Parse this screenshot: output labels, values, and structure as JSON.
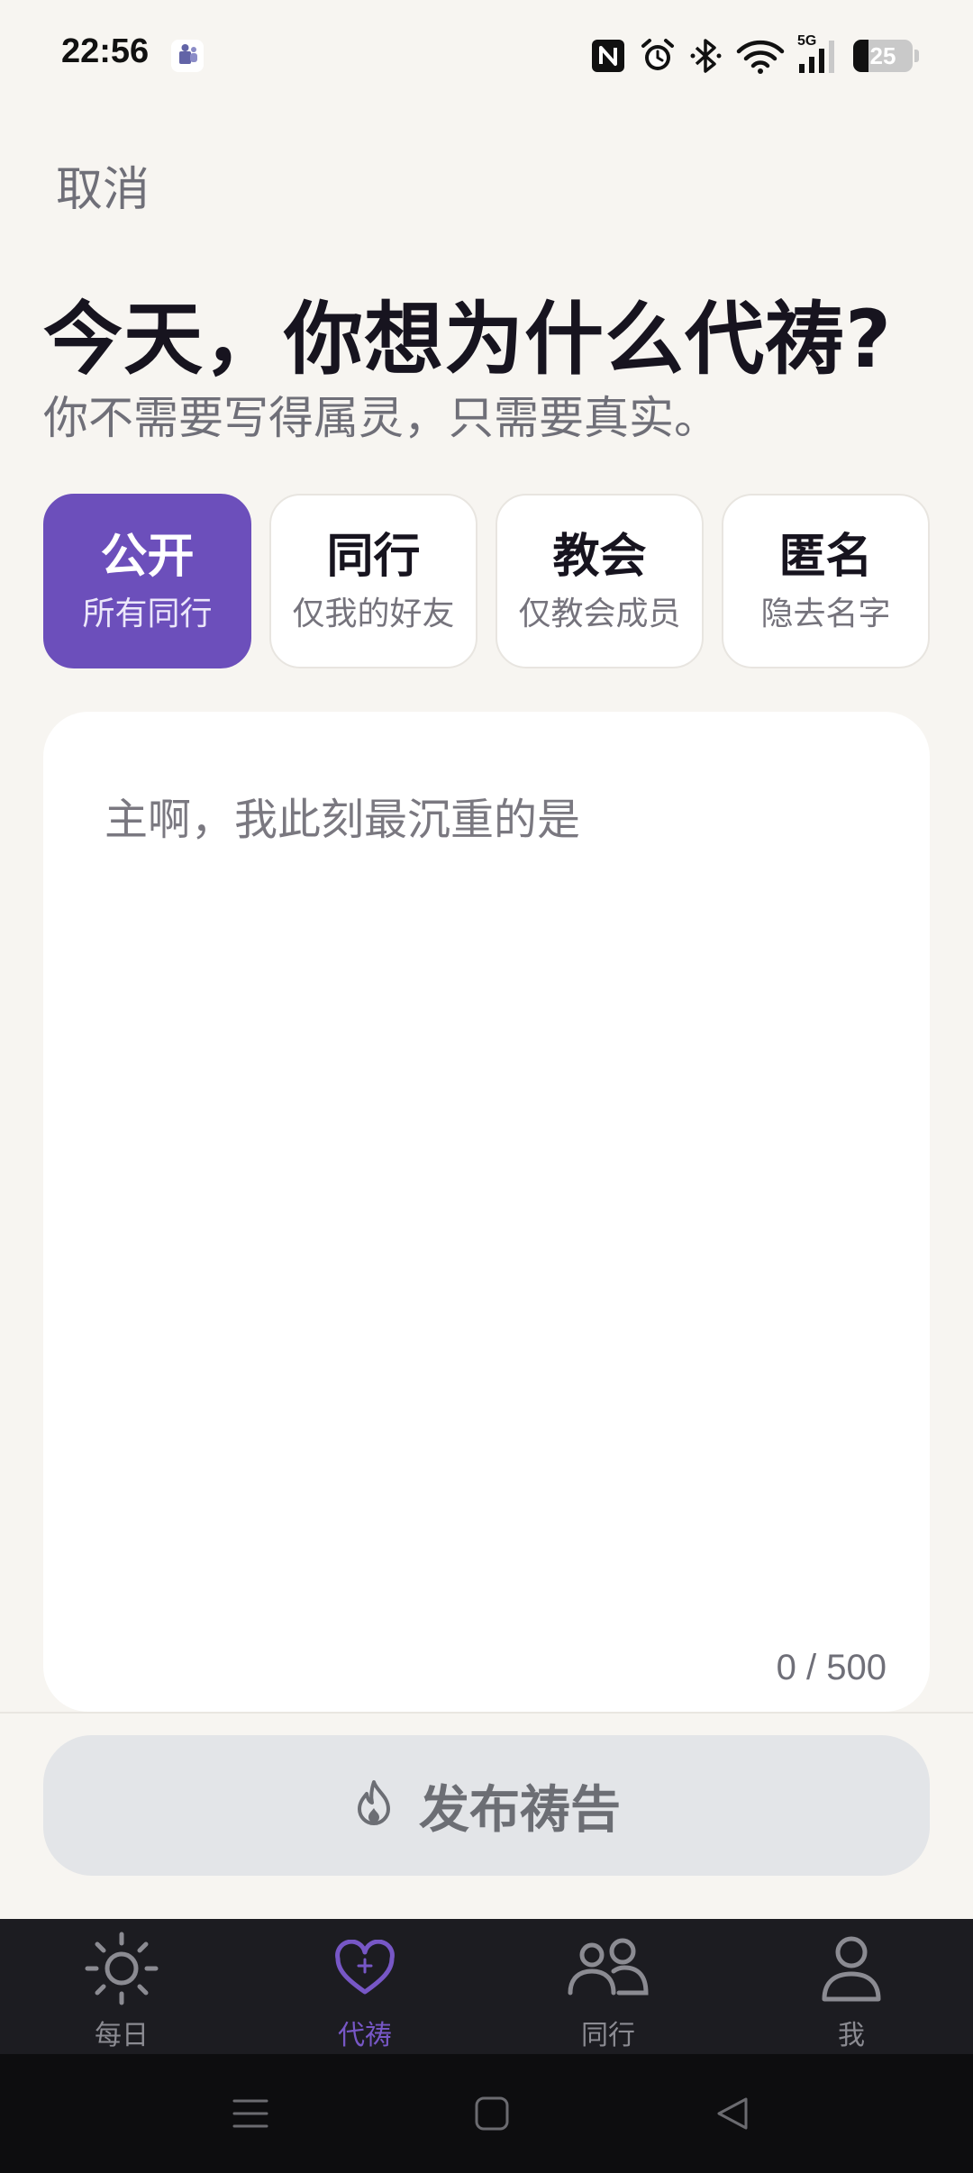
{
  "status_bar": {
    "time": "22:56",
    "network_label": "5G",
    "battery_level": "25",
    "battery_fraction": 0.25,
    "icons": [
      "nfc-icon",
      "alarm-icon",
      "bluetooth-icon",
      "wifi-icon",
      "signal-icon",
      "battery-icon"
    ]
  },
  "header": {
    "cancel_label": "取消",
    "title": "今天，你想为什么代祷?",
    "subtitle": "你不需要写得属灵，只需要真实。"
  },
  "visibility": {
    "selected_index": 0,
    "options": [
      {
        "title": "公开",
        "sub": "所有同行"
      },
      {
        "title": "同行",
        "sub": "仅我的好友"
      },
      {
        "title": "教会",
        "sub": "仅教会成员"
      },
      {
        "title": "匿名",
        "sub": "隐去名字"
      }
    ]
  },
  "prayer": {
    "value": "",
    "placeholder": "主啊，我此刻最沉重的是",
    "char_count": "0 / 500"
  },
  "publish": {
    "label": "发布祷告",
    "icon": "flame-icon"
  },
  "bottom_nav": {
    "active_index": 1,
    "items": [
      {
        "label": "每日",
        "icon": "sun-icon"
      },
      {
        "label": "代祷",
        "icon": "heart-plus-icon"
      },
      {
        "label": "同行",
        "icon": "people-icon"
      },
      {
        "label": "我",
        "icon": "person-icon"
      }
    ]
  },
  "colors": {
    "accent": "#6c4fbb",
    "background": "#f7f5f1",
    "nav_background": "#1c1c21",
    "button_disabled": "#e3e5e8"
  }
}
